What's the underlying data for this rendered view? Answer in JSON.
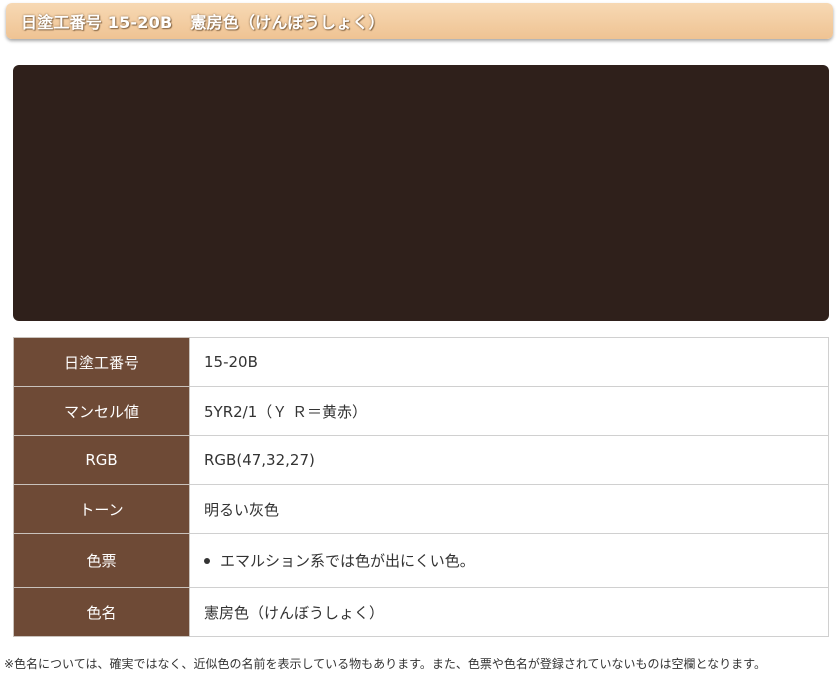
{
  "header": {
    "code": "日塗工番号 15-20B",
    "name": "憲房色（けんぼうしょく）"
  },
  "swatch": {
    "color": "#2f201b"
  },
  "table": {
    "rows": [
      {
        "label": "日塗工番号",
        "value": "15-20B"
      },
      {
        "label": "マンセル値",
        "value": "5YR2/1（Ｙ Ｒ＝黄赤）"
      },
      {
        "label": "RGB",
        "value": "RGB(47,32,27)"
      },
      {
        "label": "トーン",
        "value": "明るい灰色"
      },
      {
        "label": "色票",
        "value": "エマルション系では色が出にくい色。"
      },
      {
        "label": "色名",
        "value": "憲房色（けんぼうしょく）"
      }
    ]
  },
  "footer": {
    "note": "※色名については、確実ではなく、近似色の名前を表示している物もあります。また、色票や色名が登録されていないものは空欄となります。"
  },
  "colors": {
    "header_label_bg": "#6e4a36",
    "title_bar": "#f2cca1"
  }
}
